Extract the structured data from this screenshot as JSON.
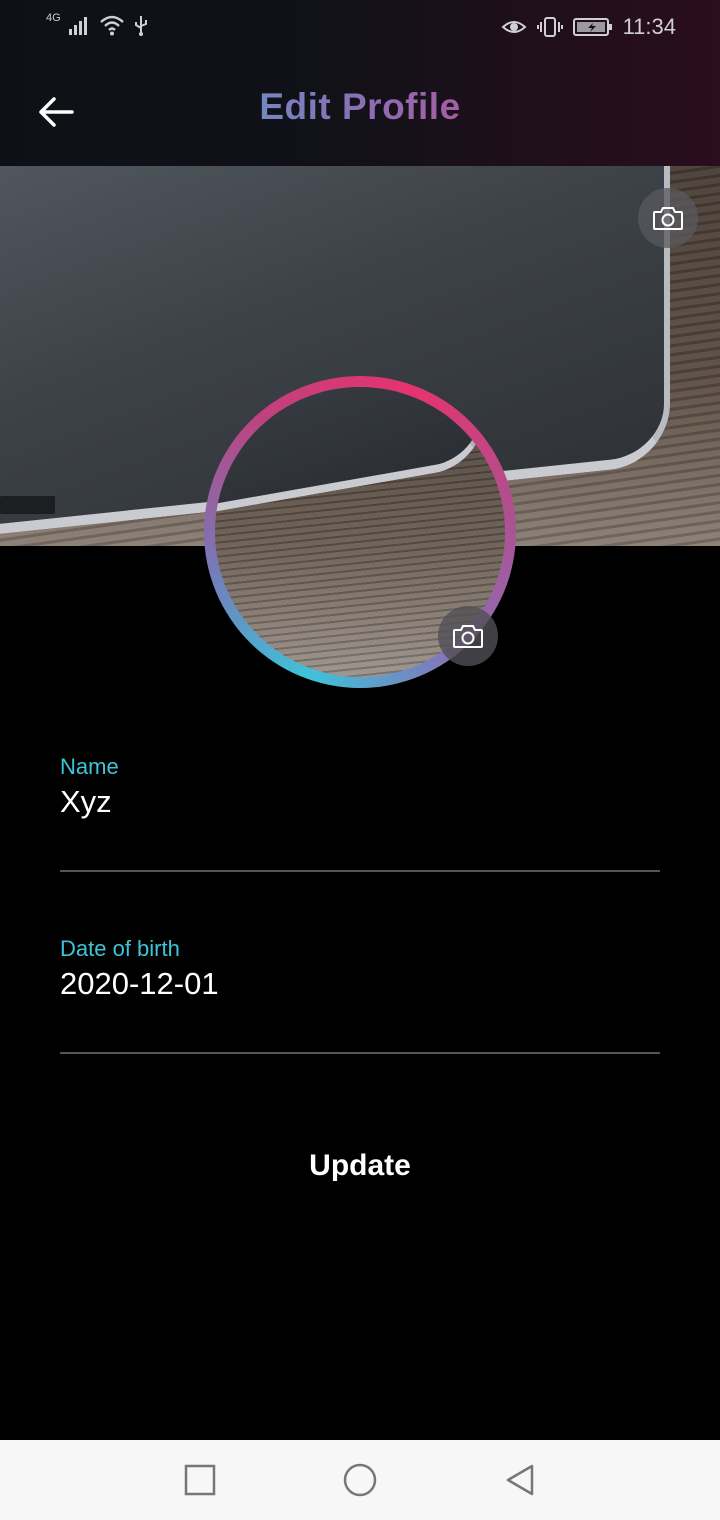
{
  "status_bar": {
    "network": "4G",
    "time": "11:34"
  },
  "header": {
    "title": "Edit Profile",
    "back_icon": "arrow-left-icon"
  },
  "cover": {
    "camera_icon": "camera-icon"
  },
  "avatar": {
    "camera_icon": "camera-icon"
  },
  "form": {
    "name_label": "Name",
    "name_value": "Xyz",
    "dob_label": "Date of birth",
    "dob_value": "2020-12-01"
  },
  "actions": {
    "update_label": "Update"
  },
  "navigation": {
    "recent_icon": "square-icon",
    "home_icon": "circle-icon",
    "back_icon": "triangle-back-icon"
  },
  "colors": {
    "accent_start": "#3ec3d9",
    "accent_end": "#e6336e",
    "background": "#000000"
  }
}
